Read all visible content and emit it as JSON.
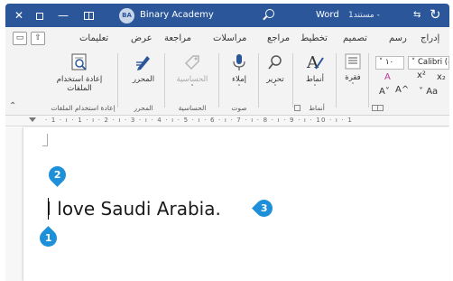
{
  "window": {
    "close_glyph": "✕",
    "minimize_glyph": "—",
    "account_initials": "BA",
    "account_name": "Binary Academy",
    "app_name": "Word",
    "doc_name": "مستند1 -",
    "qat_arrow": "⇆",
    "undo_glyph": "↻",
    "titlebar_color": "#2b579a"
  },
  "tabs": [
    "إدراج",
    "رسم",
    "تصميم",
    "تخطيط",
    "مراجع",
    "مراسلات",
    "مراجعة",
    "عرض",
    "تعليمات"
  ],
  "ribbon": {
    "reuse_files": {
      "label_line1": "إعادة استخدام",
      "label_line2": "الملفات",
      "group": "إعادة استخدام الملفات"
    },
    "editor": {
      "label": "المحرر",
      "group": "المحرر"
    },
    "sensitivity": {
      "label": "الحساسية",
      "group": "الحساسية"
    },
    "dictate": {
      "label": "إملاء",
      "group": "صوت"
    },
    "editing": {
      "label": "تحرير"
    },
    "styles": {
      "label": "أنماط",
      "group": "أنماط"
    },
    "paragraph": {
      "label": "فقرة"
    },
    "font": {
      "name": "Calibri (ب",
      "size": "١٠",
      "clear_format_glyph": "A",
      "superscript": "x²",
      "subscript": "x₂",
      "grow": "A^",
      "shrink": "A˅",
      "change_case": "Aa"
    },
    "collapse_caret": "⌃"
  },
  "ruler": {
    "numbers": "· 1 · ı · 1 · ı · 2 · ı · 3 · ı · 4 · ı · 5 · ı · 6 · ı · 7 · ı · 8 · ı · 9 · ı · 10 · ı · 1"
  },
  "document": {
    "text": "I love Saudi Arabia."
  },
  "callouts": {
    "one": "1",
    "two": "2",
    "three": "3",
    "color": "#1e90d9"
  }
}
